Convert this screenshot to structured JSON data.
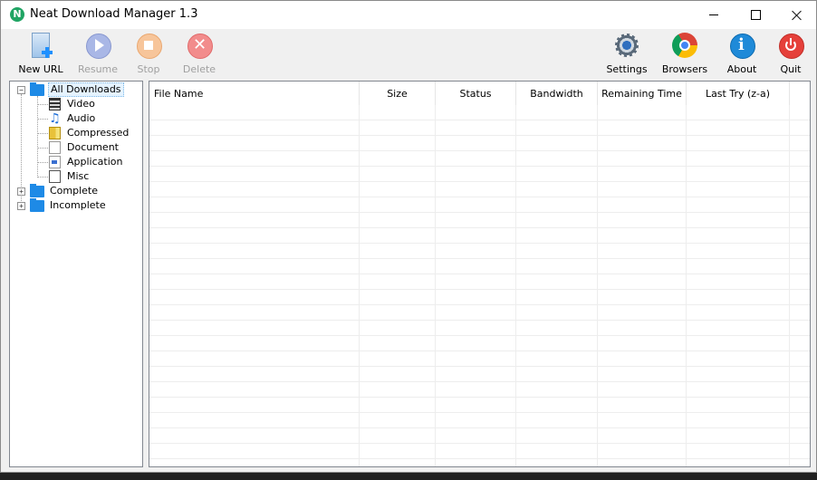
{
  "window": {
    "title": "Neat Download Manager 1.3",
    "app_icon_letter": "N"
  },
  "toolbar": {
    "new_url": "New URL",
    "resume": "Resume",
    "stop": "Stop",
    "delete": "Delete",
    "settings": "Settings",
    "browsers": "Browsers",
    "about": "About",
    "quit": "Quit"
  },
  "tree": {
    "all_downloads": "All Downloads",
    "video": "Video",
    "audio": "Audio",
    "compressed": "Compressed",
    "document": "Document",
    "application": "Application",
    "misc": "Misc",
    "complete": "Complete",
    "incomplete": "Incomplete",
    "expanded_glyph": "−",
    "collapsed_glyph": "+"
  },
  "list": {
    "columns": {
      "file_name": "File Name",
      "size": "Size",
      "status": "Status",
      "bandwidth": "Bandwidth",
      "remaining_time": "Remaining Time",
      "last_try": "Last Try (z-a)"
    }
  },
  "icons": {
    "new_url": "new-url-icon",
    "resume": "resume-icon",
    "stop": "stop-icon",
    "delete": "delete-icon",
    "settings": "gear-icon",
    "browsers": "chrome-icon",
    "about": "info-icon",
    "quit": "power-icon"
  },
  "colors": {
    "folder": "#1e8ae6",
    "disabled_text": "#a0a0a0",
    "selection": "#e5f3ff"
  }
}
